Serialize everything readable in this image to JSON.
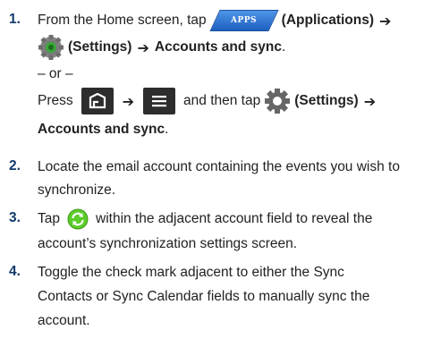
{
  "steps": [
    {
      "number": "1.",
      "from_home": "From the Home screen, tap",
      "apps_badge": "APPS",
      "applications": "(Applications)",
      "settings": "(Settings)",
      "accounts_and_sync": "Accounts and sync",
      "period": ".",
      "or_text": "– or –",
      "press": "Press",
      "and_then_tap": "and then tap",
      "settings_2": "(Settings)",
      "accounts_and_sync_2": "Accounts and sync",
      "period_2": "."
    },
    {
      "number": "2.",
      "line1": "Locate the email account containing the events you wish to",
      "line2": "synchronize."
    },
    {
      "number": "3.",
      "tap": "Tap",
      "line1_rest": "within the adjacent account field to reveal the",
      "line2": "account’s synchronization settings screen."
    },
    {
      "number": "4.",
      "line1": "Toggle the check mark adjacent to either the Sync",
      "line2": "Contacts or Sync Calendar fields to manually sync the",
      "line3": "account."
    }
  ],
  "arrow": "➔",
  "icons": {
    "apps": "apps-icon",
    "settings_green": "settings-gear-icon",
    "home_key": "home-key-icon",
    "menu_key": "menu-key-icon",
    "settings_grey": "settings-gear-icon",
    "sync": "sync-icon"
  },
  "colors": {
    "step_number": "#123a6c",
    "apps_blue": "#2a6fd4",
    "sync_green": "#4cc21e"
  }
}
